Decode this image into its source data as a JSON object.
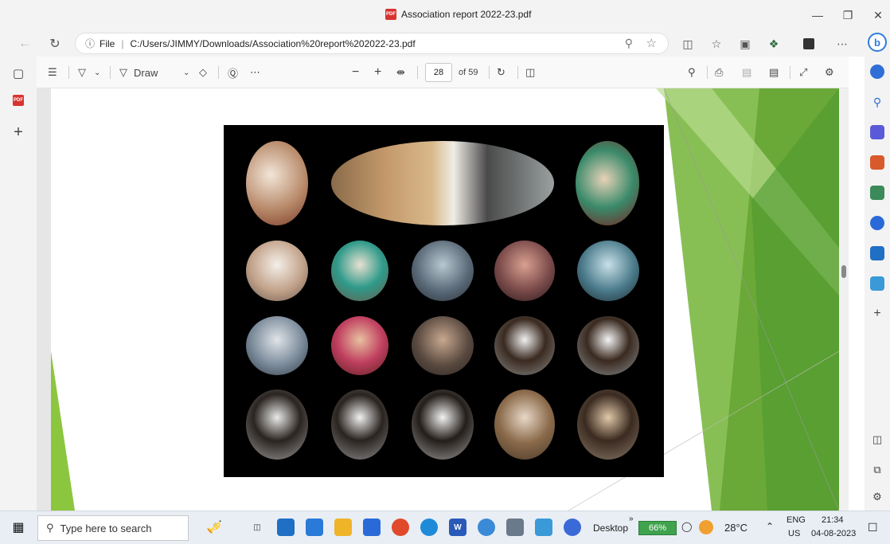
{
  "window": {
    "title": "Association report 2022-23.pdf",
    "pdf_badge": "PDF"
  },
  "addressbar": {
    "info": "ⓘ",
    "scheme": "File",
    "url": "C:/Users/JIMMY/Downloads/Association%20report%202022-23.pdf"
  },
  "pdf_toolbar": {
    "draw_label": "Draw",
    "page_current": "28",
    "page_total": "of 59"
  },
  "taskbar": {
    "search_placeholder": "Type here to search",
    "desktop_label": "Desktop",
    "battery": "66%",
    "weather": "28°C",
    "lang_top": "ENG",
    "lang_bottom": "US",
    "time": "21:34",
    "date": "04-08-2023"
  },
  "icons": [
    "back-icon",
    "refresh-icon",
    "zoom-icon",
    "favorite-icon",
    "split-screen-icon",
    "favorites-list-icon",
    "collections-icon",
    "extensions-icon",
    "profile-icon",
    "more-icon",
    "bing-icon",
    "contents-icon",
    "draw-icon",
    "erase-icon",
    "text-icon",
    "zoom-out-icon",
    "zoom-in-icon",
    "fit-page-icon",
    "rotate-icon",
    "page-view-icon",
    "search-icon",
    "print-icon",
    "save-icon",
    "save-as-icon",
    "fullscreen-icon",
    "settings-icon",
    "windows-start-icon",
    "task-view-icon"
  ]
}
